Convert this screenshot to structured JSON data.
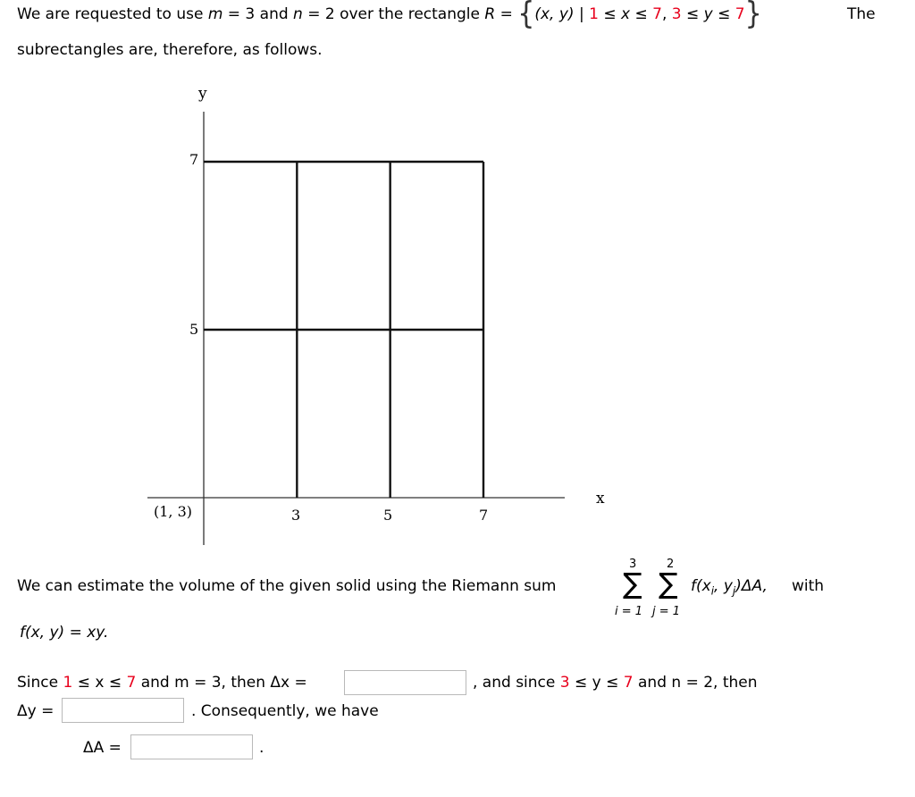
{
  "intro": {
    "line1_part1": "We are requested to use ",
    "m_var": "m",
    "eq_m": " = 3 and ",
    "n_var": "n",
    "eq_n": " = 2 over the rectangle ",
    "R_var": "R",
    "eq_R": " = ",
    "brace_open": "{",
    "set_vars": "(x, y)",
    "bar": " | ",
    "x_lo": "1",
    "le1": " ≤ ",
    "x_var": "x",
    "le2": " ≤ ",
    "x_hi": "7",
    "comma": ", ",
    "y_lo": "3",
    "le3": " ≤ ",
    "y_var": "y",
    "le4": " ≤ ",
    "y_hi": "7",
    "brace_close": "}",
    "the": "The",
    "line2": "subrectangles are, therefore, as follows."
  },
  "figure": {
    "y_axis_label": "y",
    "x_axis_label": "x",
    "origin_label": "(1, 3)",
    "y_ticks": [
      "7",
      "5"
    ],
    "x_ticks": [
      "3",
      "5",
      "7"
    ],
    "x_partition": [
      1,
      3,
      5,
      7
    ],
    "y_partition": [
      3,
      5,
      7
    ]
  },
  "riemann": {
    "text": "We can estimate the volume of the given solid using the Riemann sum",
    "outer_upper": "3",
    "inner_upper": "2",
    "outer_lower": "i = 1",
    "inner_lower": "j = 1",
    "summand": "f(x",
    "summand_i": "i",
    "summand_mid": ", y",
    "summand_j": "j",
    "summand_end": ")ΔA,",
    "with": "with",
    "function_def": "f(x, y) = xy."
  },
  "since": {
    "since_word": "Since ",
    "x_lo": "1",
    "x_mid": " ≤ x ≤ ",
    "x_hi": "7",
    "and_m": " and m = 3, then Δx =",
    "and_since": ", and since ",
    "y_lo": "3",
    "y_mid": " ≤ y ≤ ",
    "y_hi": "7",
    "and_n": " and n = 2, then",
    "dy_label": "Δy =",
    "consequently": ". Consequently, we have",
    "dA_label": "ΔA =",
    "period": "."
  },
  "inputs": {
    "delta_x": "",
    "delta_y": "",
    "delta_A": ""
  }
}
